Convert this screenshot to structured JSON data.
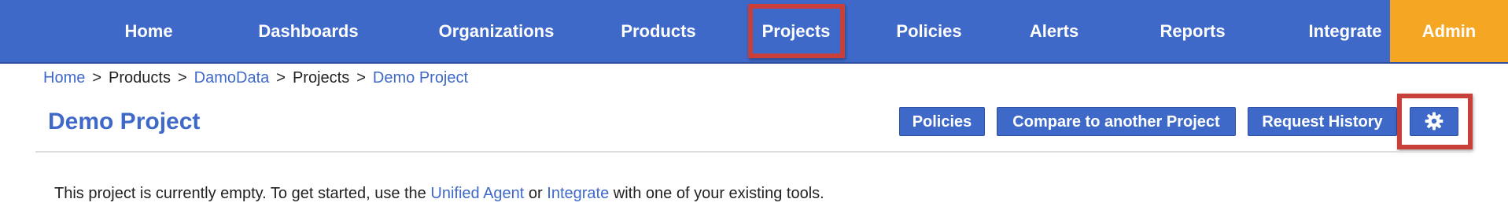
{
  "nav": {
    "items": [
      {
        "label": "Home"
      },
      {
        "label": "Dashboards"
      },
      {
        "label": "Organizations"
      },
      {
        "label": "Products"
      },
      {
        "label": "Projects"
      },
      {
        "label": "Policies"
      },
      {
        "label": "Alerts"
      },
      {
        "label": "Reports"
      },
      {
        "label": "Integrate"
      }
    ],
    "admin_label": "Admin",
    "active_item": "Projects"
  },
  "breadcrumb": {
    "items": [
      {
        "label": "Home",
        "link": true
      },
      {
        "label": "Products",
        "link": false
      },
      {
        "label": "DamoData",
        "link": true
      },
      {
        "label": "Projects",
        "link": false
      },
      {
        "label": "Demo Project",
        "link": true
      }
    ],
    "separator": ">"
  },
  "page": {
    "title": "Demo Project"
  },
  "actions": {
    "policies_label": "Policies",
    "compare_label": "Compare to another Project",
    "history_label": "Request History",
    "settings_icon": "gear-icon"
  },
  "message": {
    "prefix": "This project is currently empty. To get started, use the",
    "link1": "Unified Agent",
    "middle": "or",
    "link2": "Integrate",
    "suffix": "with one of your existing tools."
  },
  "colors": {
    "nav_bg": "#3f69c9",
    "admin_bg": "#f5a623",
    "link": "#3f69c9",
    "highlight": "#c9403a"
  }
}
